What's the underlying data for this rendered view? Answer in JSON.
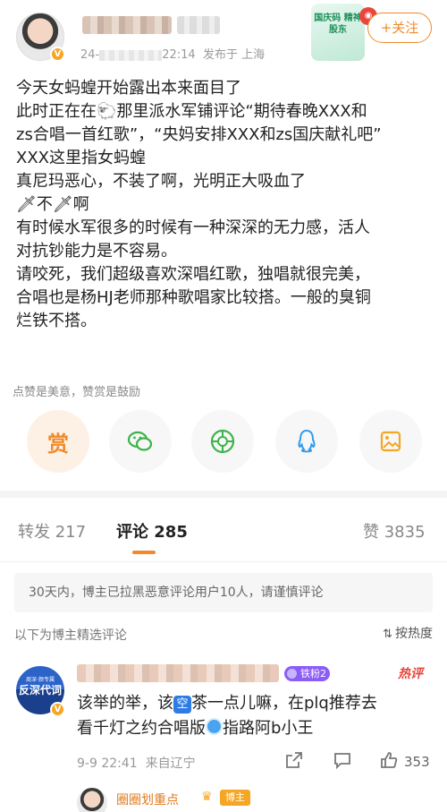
{
  "header": {
    "meta_prefix": "24-",
    "meta_time": "22:14",
    "meta_location": "发布于 上海",
    "promo_text": "国庆码 精神股东",
    "follow_label": "+关注"
  },
  "post": {
    "lines": [
      "今天女蚂蝗开始露出本来面目了",
      "此时正在在🐑那里派水军铺评论“期待春晚XXX和",
      "zs合唱一首红歌”，“央妈安排XXX和zs国庆献礼吧”",
      "XXX这里指女蚂蝗",
      "真尼玛恶心，不装了啊，光明正大吸血了",
      "🗡不🗡啊",
      "有时候水军很多的时候有一种深深的无力感，活人",
      "对抗钞能力是不容易。",
      "请咬死，我们超级喜欢深唱红歌，独唱就很完美，",
      "合唱也是杨HJ老师那种歌唱家比较搭。一般的臭铜",
      "烂铁不搭。"
    ]
  },
  "reward_hint": "点赞是美意，赞赏是鼓励",
  "actions": {
    "reward_label": "赏"
  },
  "tabs": [
    {
      "label": "转发 217"
    },
    {
      "label": "评论 285"
    },
    {
      "label": "赞 3835"
    }
  ],
  "notice": "30天内，博主已拉黑恶意评论用户10人，请谨慎评论",
  "selected_label": "以下为博主精选评论",
  "sort_label": "按热度",
  "comment": {
    "avatar_text": "反深代词",
    "avatar_small": "周深·颜专属",
    "fan_badge": "铁粉2",
    "hot_tag": "热评",
    "line1_a": "该举的举，该",
    "kong": "空",
    "line1_b": "茶一点儿嘛，在plq推荐去",
    "line2_a": "看千灯之约合唱版",
    "line2_b": "指路阿b小王",
    "time": "9-9 22:41",
    "location": "来自辽宁",
    "likes": "353"
  },
  "reply": {
    "name": "圈圈划重点",
    "tag": "博主"
  },
  "colors": {
    "accent": "#f08a2c",
    "hot": "#e8463d",
    "fan_badge": "#8b5cf6"
  }
}
